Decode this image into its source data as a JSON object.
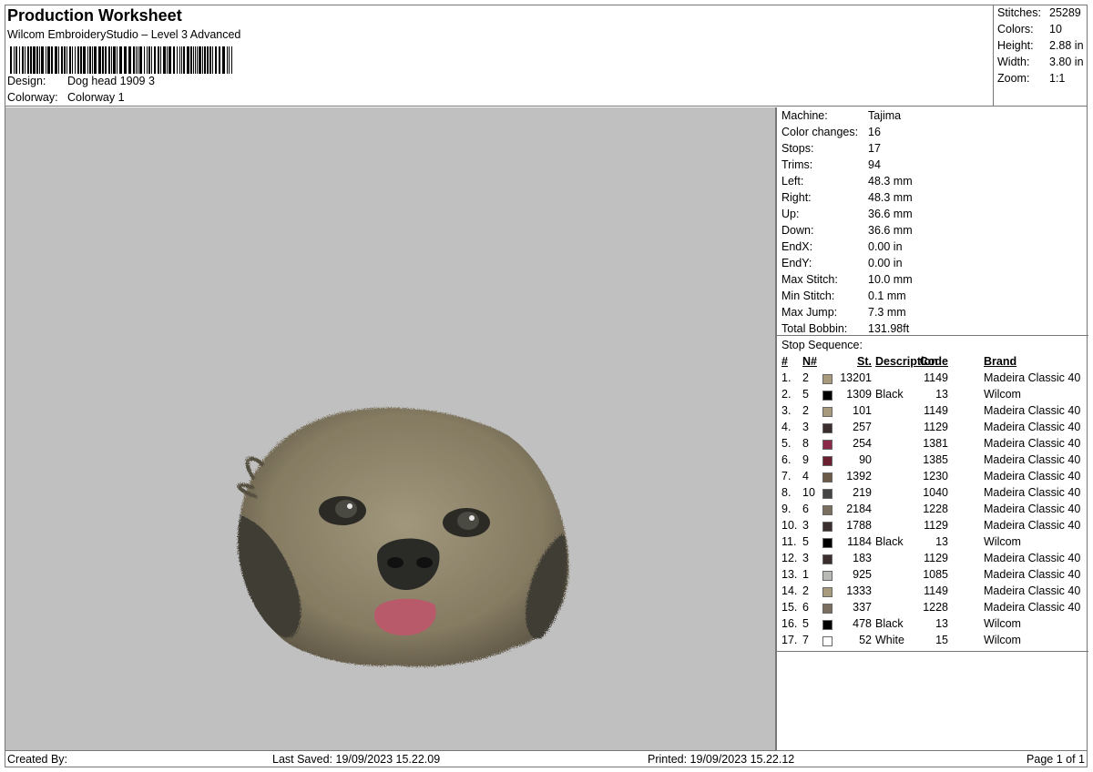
{
  "header": {
    "title": "Production Worksheet",
    "subtitle": "Wilcom EmbroideryStudio – Level 3 Advanced",
    "design_label": "Design:",
    "design_value": "Dog head 1909 3",
    "colorway_label": "Colorway:",
    "colorway_value": "Colorway 1"
  },
  "summary": {
    "stitches_label": "Stitches:",
    "stitches_value": "25289",
    "colors_label": "Colors:",
    "colors_value": "10",
    "height_label": "Height:",
    "height_value": "2.88 in",
    "width_label": "Width:",
    "width_value": "3.80 in",
    "zoom_label": "Zoom:",
    "zoom_value": "1:1"
  },
  "machine": [
    {
      "label": "Machine:",
      "value": "Tajima"
    },
    {
      "label": "Color changes:",
      "value": "16"
    },
    {
      "label": "Stops:",
      "value": "17"
    },
    {
      "label": "Trims:",
      "value": "94"
    },
    {
      "label": "Left:",
      "value": "48.3 mm"
    },
    {
      "label": "Right:",
      "value": "48.3 mm"
    },
    {
      "label": "Up:",
      "value": "36.6 mm"
    },
    {
      "label": "Down:",
      "value": "36.6 mm"
    },
    {
      "label": "EndX:",
      "value": "0.00 in"
    },
    {
      "label": "EndY:",
      "value": "0.00 in"
    },
    {
      "label": "Max Stitch:",
      "value": "10.0 mm"
    },
    {
      "label": "Min Stitch:",
      "value": "0.1 mm"
    },
    {
      "label": "Max Jump:",
      "value": "7.3 mm"
    },
    {
      "label": "Total Bobbin:",
      "value": "131.98ft"
    }
  ],
  "stop_sequence": {
    "title": "Stop Sequence:",
    "headers": {
      "num": "#",
      "n": "N#",
      "st": "St.",
      "desc": "Description",
      "code": "Code",
      "brand": "Brand"
    },
    "rows": [
      {
        "num": "1.",
        "n": "2",
        "color": "#a89a7c",
        "st": "13201",
        "desc": "",
        "code": "1149",
        "brand": "Madeira Classic 40"
      },
      {
        "num": "2.",
        "n": "5",
        "color": "#000000",
        "st": "1309",
        "desc": "Black",
        "code": "13",
        "brand": "Wilcom"
      },
      {
        "num": "3.",
        "n": "2",
        "color": "#a89a7c",
        "st": "101",
        "desc": "",
        "code": "1149",
        "brand": "Madeira Classic 40"
      },
      {
        "num": "4.",
        "n": "3",
        "color": "#3a2e2e",
        "st": "257",
        "desc": "",
        "code": "1129",
        "brand": "Madeira Classic 40"
      },
      {
        "num": "5.",
        "n": "8",
        "color": "#8a2a48",
        "st": "254",
        "desc": "",
        "code": "1381",
        "brand": "Madeira Classic 40"
      },
      {
        "num": "6.",
        "n": "9",
        "color": "#6a2030",
        "st": "90",
        "desc": "",
        "code": "1385",
        "brand": "Madeira Classic 40"
      },
      {
        "num": "7.",
        "n": "4",
        "color": "#6b5a48",
        "st": "1392",
        "desc": "",
        "code": "1230",
        "brand": "Madeira Classic 40"
      },
      {
        "num": "8.",
        "n": "10",
        "color": "#444444",
        "st": "219",
        "desc": "",
        "code": "1040",
        "brand": "Madeira Classic 40"
      },
      {
        "num": "9.",
        "n": "6",
        "color": "#7a6e60",
        "st": "2184",
        "desc": "",
        "code": "1228",
        "brand": "Madeira Classic 40"
      },
      {
        "num": "10.",
        "n": "3",
        "color": "#3a2e2e",
        "st": "1788",
        "desc": "",
        "code": "1129",
        "brand": "Madeira Classic 40"
      },
      {
        "num": "11.",
        "n": "5",
        "color": "#000000",
        "st": "1184",
        "desc": "Black",
        "code": "13",
        "brand": "Wilcom"
      },
      {
        "num": "12.",
        "n": "3",
        "color": "#3a2e2e",
        "st": "183",
        "desc": "",
        "code": "1129",
        "brand": "Madeira Classic 40"
      },
      {
        "num": "13.",
        "n": "1",
        "color": "#b8b8b4",
        "st": "925",
        "desc": "",
        "code": "1085",
        "brand": "Madeira Classic 40"
      },
      {
        "num": "14.",
        "n": "2",
        "color": "#a89a7c",
        "st": "1333",
        "desc": "",
        "code": "1149",
        "brand": "Madeira Classic 40"
      },
      {
        "num": "15.",
        "n": "6",
        "color": "#7a6e60",
        "st": "337",
        "desc": "",
        "code": "1228",
        "brand": "Madeira Classic 40"
      },
      {
        "num": "16.",
        "n": "5",
        "color": "#000000",
        "st": "478",
        "desc": "Black",
        "code": "13",
        "brand": "Wilcom"
      },
      {
        "num": "17.",
        "n": "7",
        "color": "#ffffff",
        "st": "52",
        "desc": "White",
        "code": "15",
        "brand": "Wilcom"
      }
    ]
  },
  "footer": {
    "created_by": "Created By:",
    "last_saved": "Last Saved: 19/09/2023 15.22.09",
    "printed": "Printed: 19/09/2023 15.22.12",
    "page": "Page 1 of 1"
  },
  "colors": {
    "preview_bg": "#c0c0c0",
    "fur": "#8a8068",
    "tongue": "#b85a6a"
  }
}
